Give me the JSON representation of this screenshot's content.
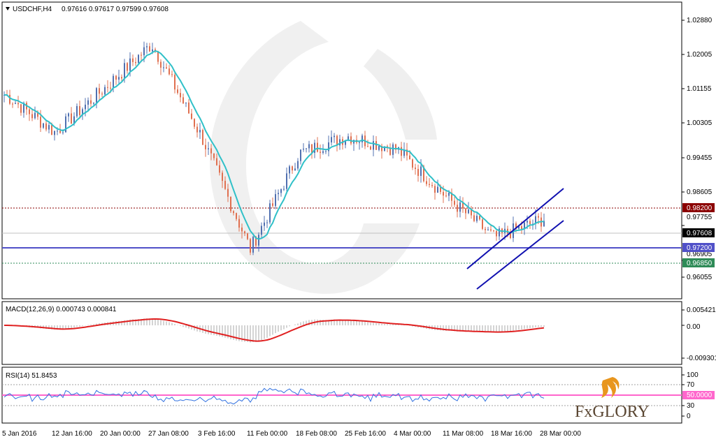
{
  "header": {
    "symbol": "USDCHF,H4",
    "ohlc": "0.97616 0.97617 0.97599 0.97608"
  },
  "price_axis": [
    "1.02880",
    "1.02005",
    "1.01155",
    "1.00305",
    "0.99455",
    "0.98605",
    "0.97755",
    "0.96905",
    "0.96055"
  ],
  "levels": [
    {
      "label": "0.98200",
      "value": 0.982,
      "color": "#8b0000",
      "style": "dotted"
    },
    {
      "label": "0.97608",
      "value": 0.97608,
      "color": "#000000",
      "style": "current"
    },
    {
      "label": "0.97200",
      "value": 0.972,
      "color": "#5050c8",
      "style": "solid"
    },
    {
      "label": "0.96850",
      "value": 0.9685,
      "color": "#2e8b57",
      "style": "dotted"
    }
  ],
  "macd": {
    "title": "MACD(12,26,9) 0.000743 0.000841",
    "axis": [
      "0.005421",
      "0.00",
      "-0.009301"
    ]
  },
  "rsi": {
    "title": "RSI(14) 51.8453",
    "axis": [
      "100",
      "70",
      "50.0000",
      "30",
      "0"
    ]
  },
  "time_axis": [
    "5 Jan 2016",
    "12 Jan 16:00",
    "20 Jan 00:00",
    "27 Jan 08:00",
    "3 Feb 16:00",
    "11 Feb 00:00",
    "18 Feb 08:00",
    "25 Feb 16:00",
    "4 Mar 00:00",
    "11 Mar 08:00",
    "18 Mar 16:00",
    "28 Mar 00:00"
  ],
  "watermark": "FxGLORY",
  "colors": {
    "bull": "#5070b0",
    "bear": "#e07050",
    "ma": "#30c0c8",
    "macd_signal": "#e02020",
    "rsi_line": "#3070e0",
    "rsi_mid": "#ff66cc",
    "channel": "#1010b0"
  },
  "chart_data": {
    "type": "line",
    "title": "USDCHF,H4",
    "ylim": [
      0.9575,
      1.0305
    ],
    "series_close_anchors": [
      {
        "x": "5 Jan 2016",
        "y": 1.009
      },
      {
        "x": "12 Jan 16:00",
        "y": 0.999
      },
      {
        "x": "20 Jan 00:00",
        "y": 1.0105
      },
      {
        "x": "27 Jan 08:00",
        "y": 1.0225
      },
      {
        "x": "3 Feb 16:00",
        "y": 0.998
      },
      {
        "x": "11 Feb 00:00",
        "y": 0.968
      },
      {
        "x": "18 Feb 08:00",
        "y": 0.9935
      },
      {
        "x": "25 Feb 16:00",
        "y": 0.998
      },
      {
        "x": "4 Mar 00:00",
        "y": 0.9945
      },
      {
        "x": "11 Mar 08:00",
        "y": 0.982
      },
      {
        "x": "18 Mar 16:00",
        "y": 0.971
      },
      {
        "x": "28 Mar 00:00",
        "y": 0.976
      }
    ],
    "macd_range": [
      -0.009301,
      0.005421
    ],
    "rsi_range": [
      0,
      100
    ],
    "rsi_last": 51.8453
  }
}
